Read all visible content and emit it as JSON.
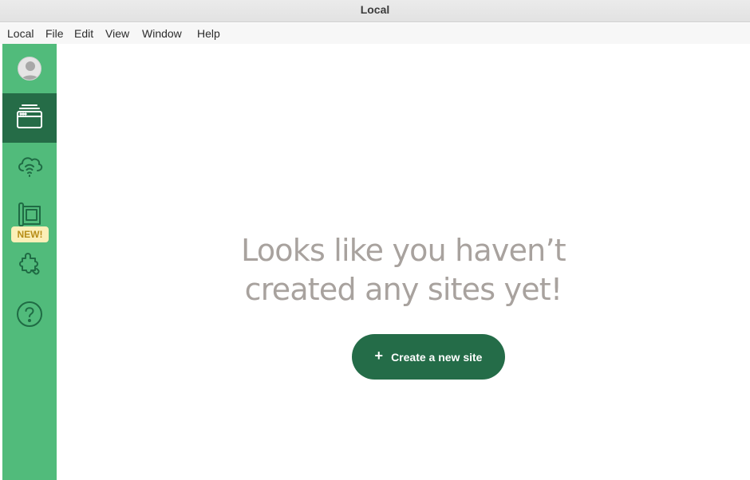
{
  "window": {
    "title": "Local"
  },
  "menubar": {
    "items": [
      "Local",
      "File",
      "Edit",
      "View",
      "Window",
      "Help"
    ]
  },
  "sidebar": {
    "items": [
      {
        "icon": "user-avatar-icon"
      },
      {
        "icon": "sites-icon",
        "active": true
      },
      {
        "icon": "cloud-connect-icon"
      },
      {
        "icon": "blueprints-icon",
        "badge": "NEW!"
      },
      {
        "icon": "addons-puzzle-icon"
      },
      {
        "icon": "help-icon"
      }
    ],
    "badge_label": "NEW!"
  },
  "main": {
    "empty_line1": "Looks like you haven’t",
    "empty_line2": "created any sites yet!",
    "create_button": {
      "icon": "+",
      "label": "Create a new site"
    }
  },
  "colors": {
    "sidebar": "#51bb7b",
    "sidebar_active": "#256c47",
    "button": "#246c48",
    "empty_text": "#a8a29e",
    "badge_bg": "#fbefb7",
    "badge_text": "#b78d17"
  }
}
